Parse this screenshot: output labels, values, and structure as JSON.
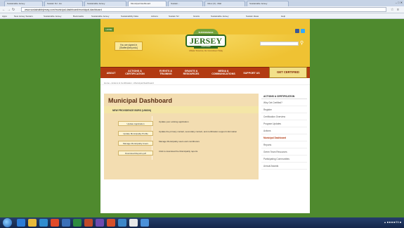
{
  "browser": {
    "tabs": [
      {
        "title": "Sustainable Jersey",
        "active": false
      },
      {
        "title": "Sustain NJ - Ho",
        "active": false
      },
      {
        "title": "Sustainable Jersey",
        "active": false
      },
      {
        "title": "Municipal Dashboard",
        "active": true
      },
      {
        "title": "Sustain...",
        "active": false
      },
      {
        "title": "Inbox (3) - Mail",
        "active": false
      },
      {
        "title": "Sustainable Jersey",
        "active": false
      }
    ],
    "url": "www.sustainablejersey.com/municipal-dashboard/municipal-dashboard",
    "bookmarks": [
      "Apps",
      "New Jersey Sustain.",
      "Sustainable Jersey",
      "Bookmarks",
      "Sustainable Jersey",
      "Sustainability Data",
      "Actions",
      "Sustain NJ",
      "Grants",
      "Sustainable Jersey",
      "Sustain Ideas",
      "Help"
    ]
  },
  "site": {
    "home_label": "HOME",
    "signed_in": {
      "line1": "You are signed in",
      "line2": "[Staffer@eny.edu]"
    },
    "logo": {
      "top": "SUSTAINABLE",
      "main": "JERSEY",
      "cert": "CERTIFIED",
      "arc": "A Better Tomorrow, Our Commitment Today"
    },
    "search_placeholder": "",
    "menu": [
      {
        "label": "ABOUT"
      },
      {
        "label": "ACTIONS & CERTIFICATION"
      },
      {
        "label": "EVENTS & TRAINING"
      },
      {
        "label": "GRANTS & RESOURCES"
      },
      {
        "label": "MEDIA & COMMUNICATIONS"
      },
      {
        "label": "SUPPORT US"
      }
    ],
    "get_certified": "GET CERTIFIED",
    "breadcrumb": "Home  ›  Actions & Certification  ›  Municipal Dashboard"
  },
  "dashboard": {
    "title": "Municipal Dashboard",
    "section_heading": "NEW PROVIDENCE BORO (UNION)",
    "actions": [
      {
        "button": "Update Application",
        "description": "Update your existing application"
      },
      {
        "button": "Update Municipality Profile",
        "description": "Update the primary contact, secondary contact, and certification support information"
      },
      {
        "button": "Manage Municipality Users",
        "description": "Manage Municipality users and contributors"
      },
      {
        "button": "Download Reports.pdf",
        "description": "Click to download the Municipality reports"
      }
    ]
  },
  "sidebar": {
    "header": "ACTIONS & CERTIFICATION",
    "items": [
      {
        "label": "Why Get Certified?",
        "active": false
      },
      {
        "label": "Register",
        "active": false
      },
      {
        "label": "Certification Overview",
        "active": false
      },
      {
        "label": "Program Updates",
        "active": false
      },
      {
        "label": "Actions",
        "active": false
      },
      {
        "label": "Municipal Dashboard",
        "active": true
      },
      {
        "label": "Reports",
        "active": false
      },
      {
        "label": "Green Team Resources",
        "active": false
      },
      {
        "label": "Participating Communities",
        "active": false
      },
      {
        "label": "Annual Awards",
        "active": false
      }
    ]
  },
  "taskbar": {
    "tray_text": "▲ ■ ■ ■ ■ EN ■"
  },
  "colors": {
    "desktop": "#4f8a2e",
    "header_yellow": "#efc233",
    "menu_red": "#b23a12",
    "panel": "#f3ddb1",
    "sidebar_active": "#b23a12"
  }
}
